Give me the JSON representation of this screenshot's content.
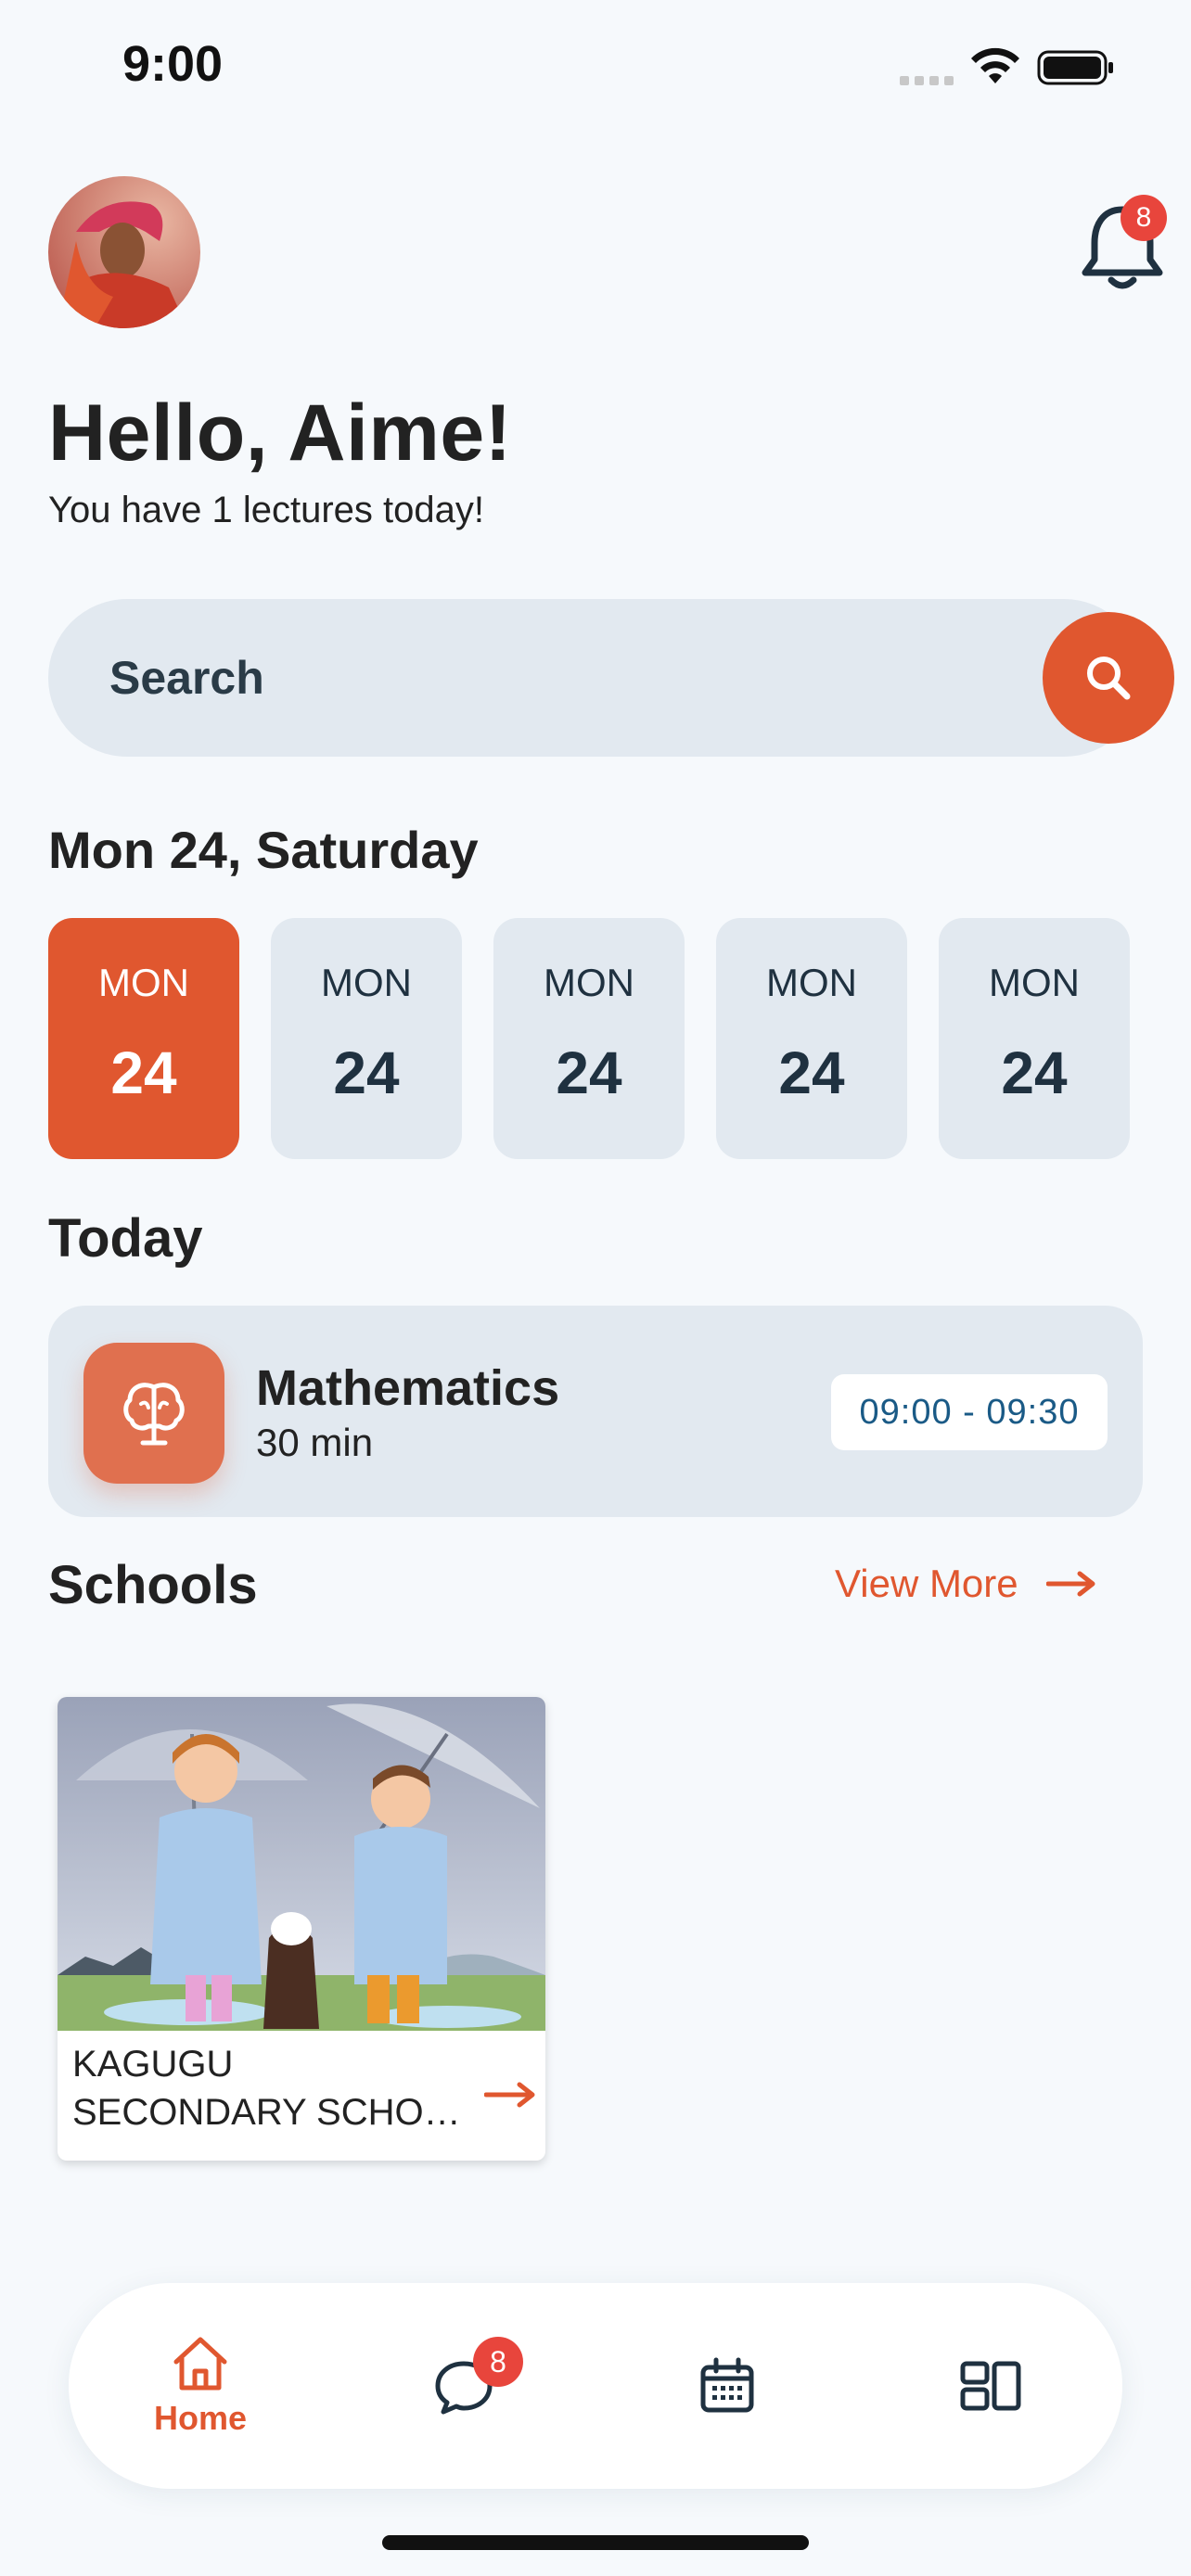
{
  "status_bar": {
    "time": "9:00"
  },
  "header": {
    "notification_count": "8",
    "greeting": "Hello, Aime!",
    "subtext": "You have 1 lectures today!"
  },
  "search": {
    "placeholder": "Search",
    "icon": "search-icon"
  },
  "date": {
    "heading": "Mon 24, Saturday",
    "days": [
      {
        "day": "MON",
        "num": "24",
        "active": true
      },
      {
        "day": "MON",
        "num": "24",
        "active": false
      },
      {
        "day": "MON",
        "num": "24",
        "active": false
      },
      {
        "day": "MON",
        "num": "24",
        "active": false
      },
      {
        "day": "MON",
        "num": "24",
        "active": false
      }
    ]
  },
  "today": {
    "heading": "Today",
    "lecture": {
      "title": "Mathematics",
      "duration": "30 min",
      "time": "09:00 - 09:30",
      "icon": "brain-icon"
    }
  },
  "schools": {
    "heading": "Schools",
    "view_more": "View More",
    "items": [
      {
        "name_line1": "KAGUGU",
        "name_line2": "SECONDARY SCHOOL"
      }
    ]
  },
  "bottom_nav": {
    "home_label": "Home",
    "messages_badge": "8",
    "items": [
      "home-icon",
      "chat-icon",
      "calendar-icon",
      "dashboard-icon"
    ]
  },
  "colors": {
    "accent": "#e0572f",
    "card_bg": "#e2e9f0",
    "badge": "#e8453c",
    "page_bg": "#f6f9fc"
  }
}
